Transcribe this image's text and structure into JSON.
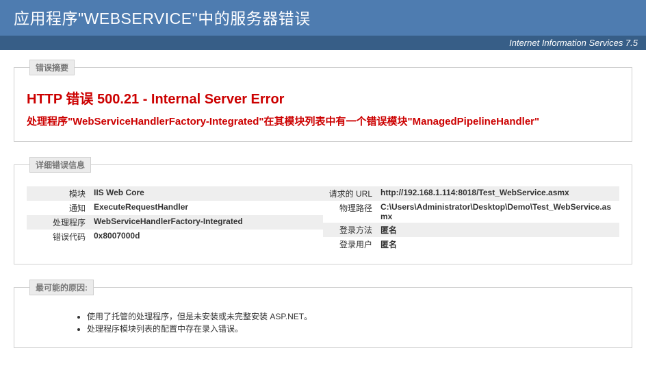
{
  "header": {
    "title": "应用程序\"WEBSERVICE\"中的服务器错误",
    "product": "Internet Information Services 7.5"
  },
  "summary": {
    "legend": "错误摘要",
    "title": "HTTP 错误 500.21 - Internal Server Error",
    "subtitle": "处理程序\"WebServiceHandlerFactory-Integrated\"在其模块列表中有一个错误模块\"ManagedPipelineHandler\""
  },
  "details": {
    "legend": "详细错误信息",
    "left": [
      {
        "label": "模块",
        "value": "IIS Web Core"
      },
      {
        "label": "通知",
        "value": "ExecuteRequestHandler"
      },
      {
        "label": "处理程序",
        "value": "WebServiceHandlerFactory-Integrated"
      },
      {
        "label": "错误代码",
        "value": "0x8007000d"
      }
    ],
    "right": [
      {
        "label": "请求的 URL",
        "value": "http://192.168.1.114:8018/Test_WebService.asmx"
      },
      {
        "label": "物理路径",
        "value": "C:\\Users\\Administrator\\Desktop\\Demo\\Test_WebService.asmx"
      },
      {
        "label": "登录方法",
        "value": "匿名"
      },
      {
        "label": "登录用户",
        "value": "匿名"
      }
    ]
  },
  "causes": {
    "legend": "最可能的原因:",
    "items": [
      "使用了托管的处理程序，但是未安装或未完整安装 ASP.NET。",
      "处理程序模块列表的配置中存在录入错误。"
    ]
  }
}
